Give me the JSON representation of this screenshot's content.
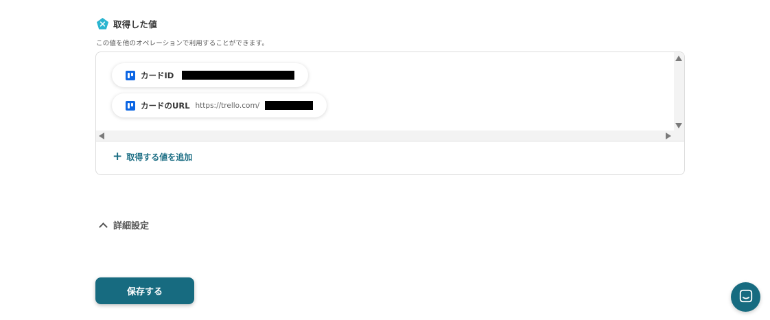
{
  "section": {
    "title": "取得した値",
    "description": "この値を他のオペレーションで利用することができます。",
    "icon": "yoom-pentagon-icon",
    "icon_color": "#2bb5d0"
  },
  "values": [
    {
      "label": "カードID",
      "value": "",
      "icon": "trello-icon"
    },
    {
      "label": "カードのURL",
      "value": "https://trello.com/",
      "icon": "trello-icon"
    }
  ],
  "add_value_label": "取得する値を追加",
  "advanced_settings_label": "詳細設定",
  "save_button_label": "保存する",
  "colors": {
    "primary": "#176b80",
    "trello": "#0c66e4",
    "accent_text": "#1c6e84"
  }
}
